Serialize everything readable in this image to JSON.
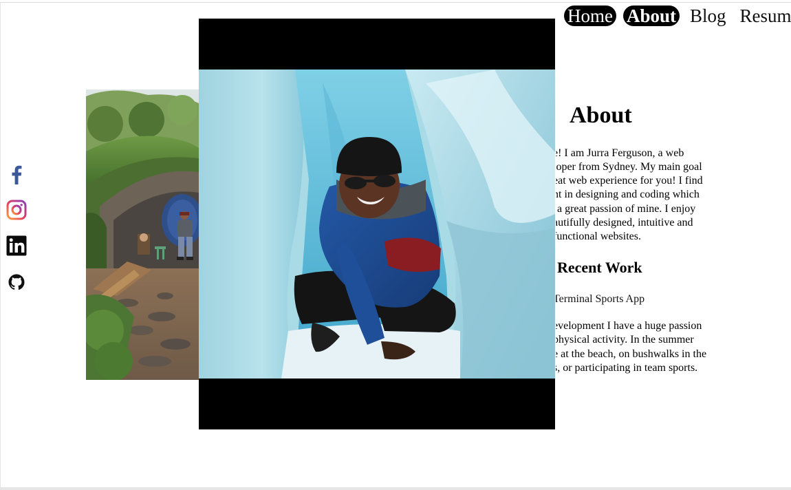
{
  "nav": {
    "items": [
      {
        "label": "Home"
      },
      {
        "label": "About"
      },
      {
        "label": "Blog"
      },
      {
        "label": "Resume"
      }
    ]
  },
  "social": {
    "icons": [
      "facebook-icon",
      "instagram-icon",
      "linkedin-icon",
      "github-icon"
    ],
    "colors": {
      "facebook": "#3b5998",
      "linkedin": "#0a0a0a",
      "github": "#111111"
    }
  },
  "about": {
    "heading": "About",
    "intro_lines": [
      "e! I am Jurra Ferguson, a web",
      "loper from Sydney. My main goal",
      "eat web experience for you! I find",
      "nt in designing and coding which",
      "a great passion of mine. I enjoy",
      "autifully designed, intuitive and",
      "functional websites."
    ],
    "recent_heading": "Recent Work",
    "project_label": "Terminal Sports App",
    "hobby_lines": [
      "evelopment I have a huge passion",
      "physical activity. In the summer",
      "e at the beach, on bushwalks in the",
      "s, or participating in team sports."
    ]
  }
}
